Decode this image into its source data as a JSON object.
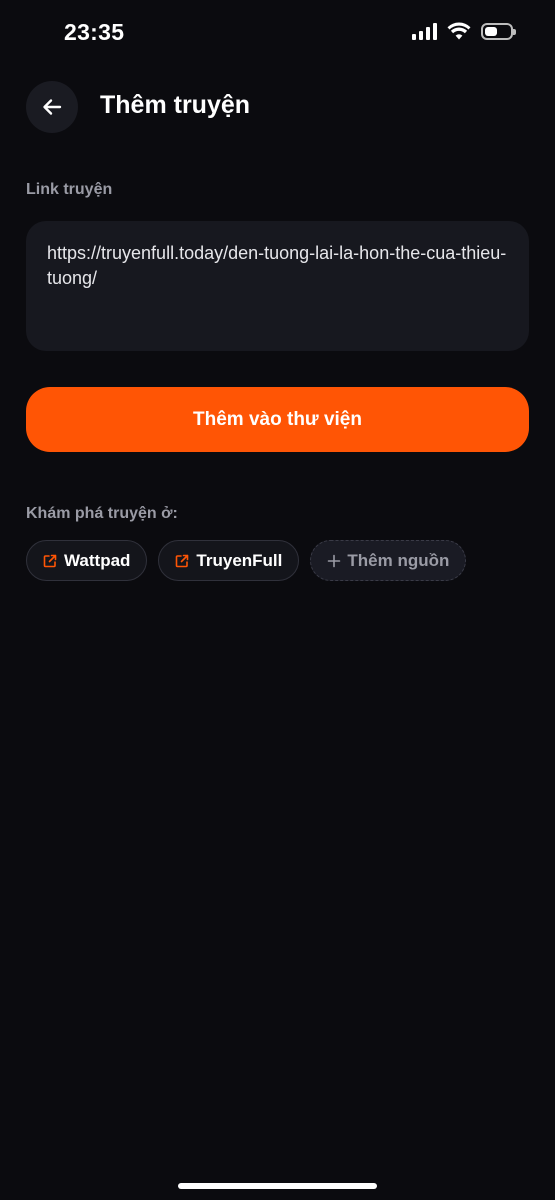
{
  "status_bar": {
    "time": "23:35",
    "battery_level": 0.5,
    "icons": [
      "signal-icon",
      "wifi-icon",
      "battery-icon"
    ]
  },
  "header": {
    "back_icon": "arrow-left-icon",
    "title": "Thêm truyện"
  },
  "link_field": {
    "label": "Link truyện",
    "value": "https://truyenfull.today/den-tuong-lai-la-hon-the-cua-thieu-tuong/"
  },
  "add_button": {
    "label": "Thêm vào thư viện"
  },
  "explore": {
    "label": "Khám phá truyện ở:",
    "sources": [
      {
        "label": "Wattpad",
        "icon": "external-link-icon"
      },
      {
        "label": "TruyenFull",
        "icon": "external-link-icon"
      }
    ],
    "add_source": {
      "label": "Thêm nguồn",
      "icon": "plus-icon"
    }
  },
  "colors": {
    "background": "#0b0b0f",
    "accent": "#ff5505",
    "surface": "#17181f",
    "muted_text": "#9a9ba5"
  }
}
